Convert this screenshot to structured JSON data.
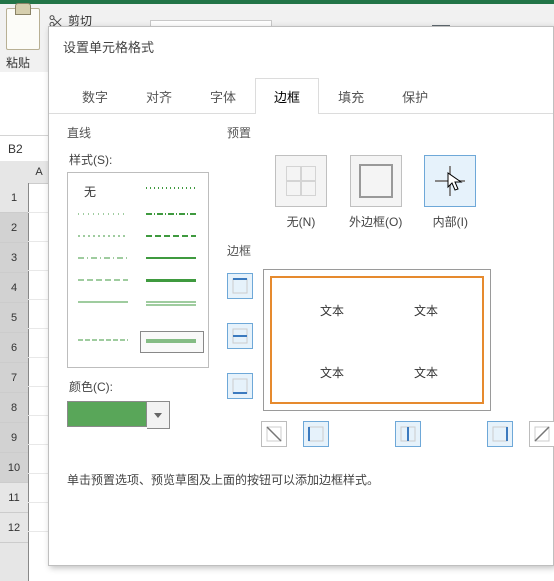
{
  "ribbon": {
    "paste_label": "粘贴",
    "cut_label": "剪切"
  },
  "name_box": {
    "value": "B2"
  },
  "columns": [
    "A"
  ],
  "rows": [
    "1",
    "2",
    "3",
    "4",
    "5",
    "6",
    "7",
    "8",
    "9",
    "10",
    "11",
    "12"
  ],
  "dialog": {
    "title": "设置单元格格式",
    "tabs": {
      "number": "数字",
      "alignment": "对齐",
      "font": "字体",
      "border": "边框",
      "fill": "填充",
      "protection": "保护"
    },
    "line": {
      "section": "直线",
      "style_label": "样式(S):",
      "none_label": "无",
      "color_label": "颜色(C):",
      "color_value": "#59a659"
    },
    "presets": {
      "section": "预置",
      "none": "无(N)",
      "outline": "外边框(O)",
      "inside": "内部(I)"
    },
    "border": {
      "section": "边框",
      "sample_text": "文本"
    },
    "help": "单击预置选项、预览草图及上面的按钮可以添加边框样式。"
  }
}
